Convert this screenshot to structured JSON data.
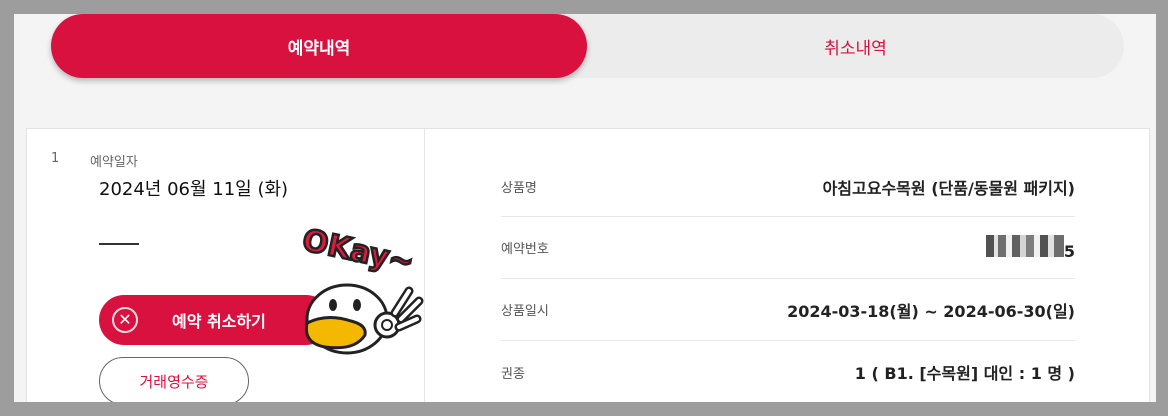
{
  "tabs": [
    {
      "label": "예약내역",
      "active": true
    },
    {
      "label": "취소내역",
      "active": false
    }
  ],
  "reservation": {
    "index": "1",
    "date_label": "예약일자",
    "date_value": "2024년 06월 11일 (화)",
    "cancel_button": "예약 취소하기",
    "receipt_button": "거래영수증"
  },
  "details": [
    {
      "label": "상품명",
      "value": "아침고요수목원 (단품/동물원 패키지)"
    },
    {
      "label": "예약번호",
      "value_suffix": "5"
    },
    {
      "label": "상품일시",
      "value": "2024-03-18(월) ~ 2024-06-30(일)"
    },
    {
      "label": "권종",
      "value": "1 ( B1. [수목원] 대인 : 1 명 )"
    }
  ],
  "mascot": {
    "text": "OKay~"
  },
  "colors": {
    "accent": "#d8113f",
    "tab_bg": "#ececec"
  }
}
